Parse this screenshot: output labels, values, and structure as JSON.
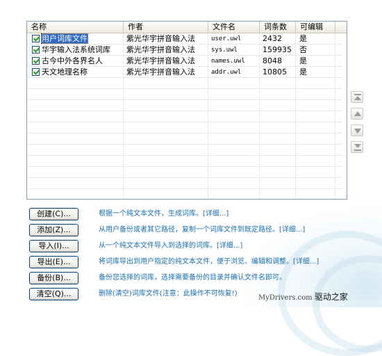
{
  "columns": [
    "名称",
    "作者",
    "文件名",
    "词条数",
    "可编辑"
  ],
  "rows": [
    {
      "name": "用户词库文件",
      "author": "紫光华宇拼音输入法",
      "file": "user.uwl",
      "count": "2432",
      "editable": "是",
      "checked": true,
      "selected": true
    },
    {
      "name": "华宇输入法系统词库",
      "author": "紫光华宇拼音输入法",
      "file": "sys.uwl",
      "count": "159935",
      "editable": "否",
      "checked": true,
      "selected": false
    },
    {
      "name": "古今中外各界名人",
      "author": "紫光华宇拼音输入法",
      "file": "names.uwl",
      "count": "8048",
      "editable": "是",
      "checked": true,
      "selected": false
    },
    {
      "name": "天文地理名称",
      "author": "紫光华宇拼音输入法",
      "file": "addr.uwl",
      "count": "10805",
      "editable": "是",
      "checked": true,
      "selected": false
    }
  ],
  "side_buttons": [
    "move-top",
    "move-up",
    "move-down",
    "move-bottom"
  ],
  "actions": [
    {
      "label": "创建(C)...",
      "desc": "根据一个纯文本文件，生成词库。[详细...]"
    },
    {
      "label": "添加(Z)...",
      "desc": "从用户备份或者其它路径，复制一个词库文件到既定路径。[详细...]"
    },
    {
      "label": "导入(I)...",
      "desc": "从一个纯文本文件导入到选择的词库。[详细...]"
    },
    {
      "label": "导出(E)...",
      "desc": "将词库导出到用户指定的纯文本文件，便于浏览、编辑和调整。[详细...]"
    },
    {
      "label": "备份(B)...",
      "desc": "备份您选择的词库，选择需要备份的目录并确认文件名即可。"
    },
    {
      "label": "清空(Q)...",
      "desc": "删除(清空)词库文件(注意：此操作不可恢复!)"
    }
  ],
  "watermark": {
    "site": "MyDrivers.com",
    "brand": "驱动之家"
  },
  "colors": {
    "selection": "#316ac5",
    "link_text": "#1a6fb0",
    "border": "#7f9db9"
  }
}
